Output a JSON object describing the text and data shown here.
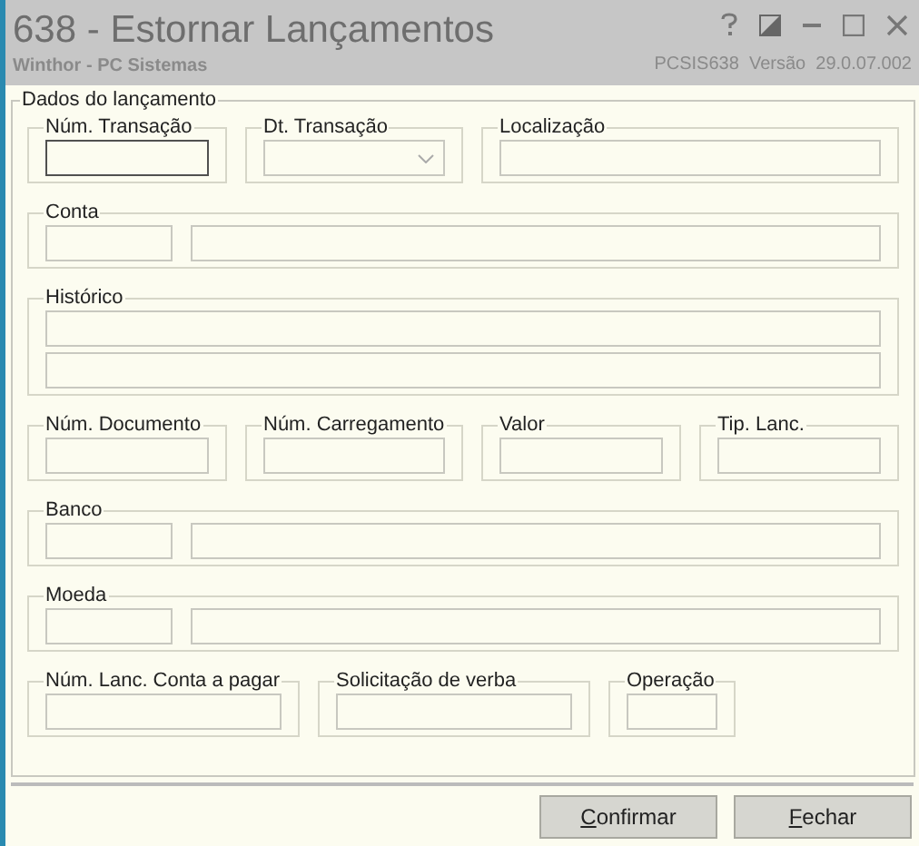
{
  "window": {
    "title": "638 - Estornar Lançamentos",
    "subtitle": "Winthor - PC Sistemas",
    "version": "PCSIS638  Versão  29.0.07.002"
  },
  "form": {
    "legend": "Dados do lançamento",
    "rows": [
      {
        "groups": [
          {
            "label": "Núm. Transação",
            "fields": [
              {
                "kind": "text",
                "focused": true
              }
            ]
          },
          {
            "label": "Dt. Transação",
            "fields": [
              {
                "kind": "dropdown",
                "focused": false
              }
            ]
          },
          {
            "label": "Localização",
            "fields": [
              {
                "kind": "text",
                "focused": false
              }
            ]
          }
        ]
      },
      {
        "groups": [
          {
            "label": "Conta",
            "fields": [
              {
                "kind": "text",
                "focused": false
              },
              {
                "kind": "text",
                "focused": false
              }
            ]
          }
        ]
      },
      {
        "groups": [
          {
            "label": "Histórico",
            "fields": [
              {
                "kind": "text",
                "focused": false
              },
              {
                "kind": "text",
                "focused": false
              }
            ]
          }
        ]
      },
      {
        "groups": [
          {
            "label": "Núm. Documento",
            "fields": [
              {
                "kind": "text",
                "focused": false
              }
            ]
          },
          {
            "label": "Núm. Carregamento",
            "fields": [
              {
                "kind": "text",
                "focused": false
              }
            ]
          },
          {
            "label": "Valor",
            "fields": [
              {
                "kind": "text",
                "focused": false
              }
            ]
          },
          {
            "label": "Tip. Lanc.",
            "fields": [
              {
                "kind": "text",
                "focused": false
              }
            ]
          }
        ]
      },
      {
        "groups": [
          {
            "label": "Banco",
            "fields": [
              {
                "kind": "text",
                "focused": false
              },
              {
                "kind": "text",
                "focused": false
              }
            ]
          }
        ]
      },
      {
        "groups": [
          {
            "label": "Moeda",
            "fields": [
              {
                "kind": "text",
                "focused": false
              },
              {
                "kind": "text",
                "focused": false
              }
            ]
          }
        ]
      },
      {
        "groups": [
          {
            "label": "Núm. Lanc. Conta a pagar",
            "fields": [
              {
                "kind": "text",
                "focused": false
              }
            ]
          },
          {
            "label": "Solicitação de verba",
            "fields": [
              {
                "kind": "text",
                "focused": false
              }
            ]
          },
          {
            "label": "Operação",
            "fields": [
              {
                "kind": "text",
                "focused": false
              }
            ]
          }
        ]
      }
    ]
  },
  "buttons": [
    {
      "label": "Confirmar"
    },
    {
      "label": "Fechar"
    }
  ]
}
